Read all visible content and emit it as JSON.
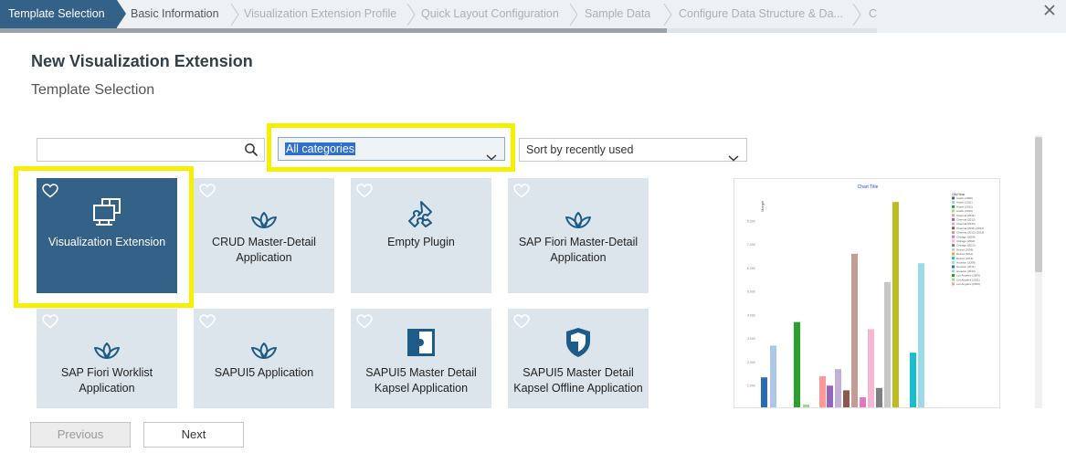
{
  "wizard": {
    "steps": [
      {
        "label": "Template Selection",
        "state": "active"
      },
      {
        "label": "Basic Information",
        "state": "next"
      },
      {
        "label": "Visualization Extension Profile",
        "state": "disabled"
      },
      {
        "label": "Quick Layout Configuration",
        "state": "disabled"
      },
      {
        "label": "Sample Data",
        "state": "disabled"
      },
      {
        "label": "Configure Data Structure & Da...",
        "state": "disabled"
      },
      {
        "label": "C",
        "state": "disabled"
      }
    ],
    "progress_fraction": 0.76,
    "close_icon": "close-icon"
  },
  "page": {
    "title": "New Visualization Extension",
    "subtitle": "Template Selection"
  },
  "filters": {
    "search": {
      "value": "",
      "placeholder": "",
      "icon": "search-icon"
    },
    "category": {
      "selected": "All categories"
    },
    "sort": {
      "selected": "Sort by recently used"
    }
  },
  "templates": [
    {
      "label": "Visualization Extension",
      "icon": "visualization-extension-icon",
      "selected": true
    },
    {
      "label": "CRUD Master-Detail Application",
      "icon": "sap-fiori-icon",
      "selected": false
    },
    {
      "label": "Empty Plugin",
      "icon": "puzzle-icon",
      "selected": false
    },
    {
      "label": "SAP Fiori Master-Detail Application",
      "icon": "sap-fiori-icon",
      "selected": false
    },
    {
      "label": "SAP Fiori Worklist Application",
      "icon": "sap-fiori-icon",
      "selected": false
    },
    {
      "label": "SAPUI5 Application",
      "icon": "sap-fiori-icon",
      "selected": false
    },
    {
      "label": "SAPUI5 Master Detail Kapsel Application",
      "icon": "kapsel-icon",
      "selected": false
    },
    {
      "label": "SAPUI5 Master Detail Kapsel Offline Application",
      "icon": "shield-icon",
      "selected": false
    }
  ],
  "preview_chart": {
    "title": "Chart Title",
    "y_axis_label": "Margin",
    "legend_title": "City/Year",
    "legend_items": [
      "Austin (2009)",
      "Austin (2011)",
      "Austin (2012)",
      "Austin (2013)",
      "Chennai (2011)",
      "Chennai (2012)",
      "Chennai (2013)",
      "Chennai (2011) (2012)",
      "Chennai (2012) (2013)",
      "Chicago (2009)",
      "Chicago (2011)",
      "Chicago (2013)",
      "Detroit (2009)",
      "Detroit (2011)",
      "Detroit (2013)",
      "Houston (2009)",
      "Houston (2011)",
      "Houston (2013)",
      "Los Angeles (2009)",
      "Los Angeles (2011)",
      "Los Angeles (2013)"
    ],
    "y_ticks": [
      "8,000",
      "7,000",
      "6,000",
      "5,000",
      "4,000",
      "3,000",
      "2,000",
      "1,000"
    ],
    "bars": [
      {
        "value": 1350,
        "color": "#2b6cb0"
      },
      {
        "value": 2700,
        "color": "#aec7e8"
      },
      {
        "value": 3700,
        "color": "#2ca02c"
      },
      {
        "value": 200,
        "color": "#98df8a"
      },
      {
        "value": 1400,
        "color": "#ff9896"
      },
      {
        "value": 1000,
        "color": "#9467bd"
      },
      {
        "value": 1700,
        "color": "#c5b0d5"
      },
      {
        "value": 800,
        "color": "#8c564b"
      },
      {
        "value": 6600,
        "color": "#c49c94"
      },
      {
        "value": 500,
        "color": "#e377c2"
      },
      {
        "value": 3400,
        "color": "#f7b6d2"
      },
      {
        "value": 900,
        "color": "#7f7f7f"
      },
      {
        "value": 5400,
        "color": "#c7c7c7"
      },
      {
        "value": 8800,
        "color": "#bcbd22"
      },
      {
        "value": 2400,
        "color": "#17becf"
      },
      {
        "value": 6200,
        "color": "#9edae5"
      }
    ]
  },
  "buttons": {
    "previous": "Previous",
    "next": "Next"
  },
  "colors": {
    "accent": "#346187",
    "highlight": "#f4f000",
    "tile_bg": "#dde5ec"
  }
}
